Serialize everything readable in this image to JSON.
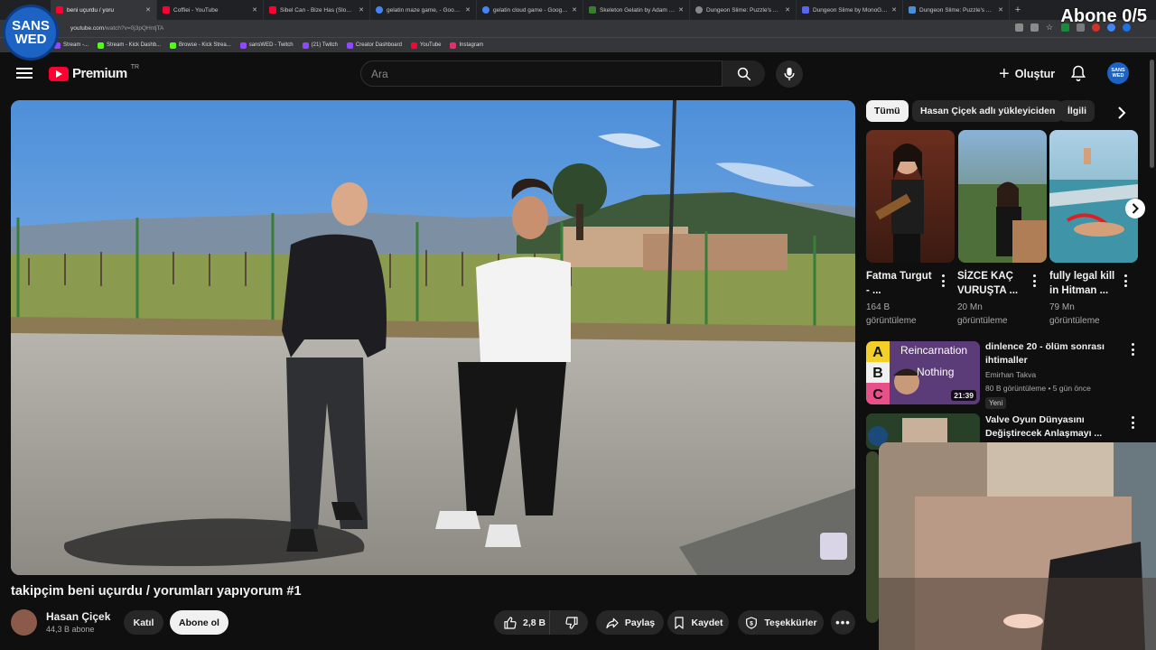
{
  "browser": {
    "tabs": [
      {
        "title": "beni uçurdu / yoru",
        "color": "#ff0033",
        "active": true
      },
      {
        "title": "Coffiei - YouTube",
        "color": "#ff0033"
      },
      {
        "title": "Sibel Can - Bize Has (Slowed -",
        "color": "#ff0033"
      },
      {
        "title": "gelatin maze game, - Google'd",
        "color": "#4285f4"
      },
      {
        "title": "gelatin cloud game - Google'd",
        "color": "#4285f4"
      },
      {
        "title": "Skeleton Gelatin by Adam Saltz",
        "color": "#3a7d2c"
      },
      {
        "title": "Dungeon Slime: Puzzle's Adven",
        "color": "#888888"
      },
      {
        "title": "Dungeon Slime by MonoGame",
        "color": "#5865f2"
      },
      {
        "title": "Dungeon Slime: Puzzle's Adven",
        "color": "#4a90d9"
      }
    ],
    "new_tab": "+",
    "url_main": "youtube.com",
    "url_rest": "/watch?v=0j3pQHntjTA",
    "bookmarks": [
      {
        "label": "Stream -...",
        "color": "#9147ff"
      },
      {
        "label": "Stream - Kick Dashb...",
        "color": "#53fc18"
      },
      {
        "label": "Browse - Kick Strea...",
        "color": "#53fc18"
      },
      {
        "label": "sansWED - Twitch",
        "color": "#9147ff"
      },
      {
        "label": "(21) Twitch",
        "color": "#9147ff"
      },
      {
        "label": "Creator Dashboard",
        "color": "#9147ff"
      },
      {
        "label": "YouTube",
        "color": "#ff0033"
      },
      {
        "label": "Instagram",
        "color": "#e1306c"
      }
    ]
  },
  "overlay": {
    "logo_line1": "SANS",
    "logo_line2": "WED",
    "goal": "Abone 0/5"
  },
  "masthead": {
    "logo_text": "Premium",
    "country": "TR",
    "search_placeholder": "Ara",
    "create_label": "Oluştur",
    "avatar_line1": "SANS",
    "avatar_line2": "WED"
  },
  "video": {
    "title": "takipçim beni uçurdu / yorumları yapıyorum #1",
    "channel": "Hasan Çiçek",
    "subscribers": "44,3 B abone",
    "join": "Katıl",
    "subscribe": "Abone ol",
    "likes": "2,8 B",
    "share": "Paylaş",
    "save": "Kaydet",
    "thanks": "Teşekkürler"
  },
  "sidebar": {
    "chips": [
      "Tümü",
      "Hasan Çiçek adlı yükleyiciden",
      "İlgili"
    ],
    "shorts": [
      {
        "title": "Fatma Turgut - ...",
        "views": "164 B görüntüleme",
        "overlay": "..."
      },
      {
        "title": "SİZCE KAÇ VURUŞTA ...",
        "views": "20 Mn görüntüleme"
      },
      {
        "title": "fully legal kill in Hitman ...",
        "views": "79 Mn görüntüleme"
      }
    ],
    "videos": [
      {
        "title": "dinlence 20 - ölüm sonrası ihtimaller",
        "channel": "Emirhan Takva",
        "meta": "80 B görüntüleme • 5 gün önce",
        "badge": "Yeni",
        "duration": "21:39",
        "thumb_text1": "Reincarnation",
        "thumb_text2": "Nothing",
        "letters": [
          "A",
          "B",
          "C"
        ]
      },
      {
        "title": "Valve Oyun Dünyasını Değiştirecek Anlaşmayı ...",
        "channel": "",
        "meta": ""
      }
    ]
  },
  "colors": {
    "background": "#0f0f0f",
    "chip_bg": "#272727",
    "youtube_red": "#ff0033",
    "brand_blue": "#1c63c4"
  }
}
